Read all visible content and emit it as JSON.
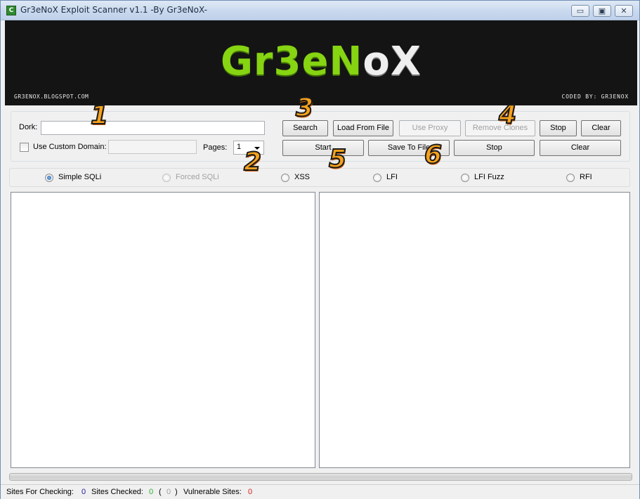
{
  "window": {
    "title": "Gr3eNoX Exploit Scanner v1.1 -By Gr3eNoX-",
    "app_icon_glyph": "C",
    "controls": {
      "minimize": "▭",
      "maximize": "▣",
      "close": "✕"
    }
  },
  "banner": {
    "logo_green": "Gr3e",
    "logo_green2": "N",
    "logo_white": "oX",
    "blog": "GR3ENOX.BLOGSPOT.COM",
    "coded_by": "CODED BY: GR3ENOX"
  },
  "search": {
    "dork_label": "Dork:",
    "dork_value": "",
    "custom_domain_label": "Use Custom Domain:",
    "custom_domain_checked": false,
    "custom_domain_value": "",
    "pages_label": "Pages:",
    "pages_value": "1"
  },
  "buttons": {
    "search": "Search",
    "load_from_file": "Load From File",
    "use_proxy": "Use Proxy",
    "remove_clones": "Remove Clones",
    "stop_top": "Stop",
    "clear_top": "Clear",
    "start": "Start",
    "save_to_file": "Save To File",
    "stop_bottom": "Stop",
    "clear_bottom": "Clear"
  },
  "scan_modes": [
    {
      "label": "Simple SQLi",
      "checked": true,
      "enabled": true
    },
    {
      "label": "Forced SQLi",
      "checked": false,
      "enabled": false
    },
    {
      "label": "XSS",
      "checked": false,
      "enabled": true
    },
    {
      "label": "LFI",
      "checked": false,
      "enabled": true
    },
    {
      "label": "LFI Fuzz",
      "checked": false,
      "enabled": true
    },
    {
      "label": "RFI",
      "checked": false,
      "enabled": true
    }
  ],
  "status": {
    "sites_for_checking_label": "Sites For Checking:",
    "sites_for_checking": "0",
    "sites_checked_label": "Sites Checked:",
    "sites_checked": "0",
    "paren_open": "(",
    "sites_checked_secondary": "0",
    "paren_close": ")",
    "vulnerable_label": "Vulnerable Sites:",
    "vulnerable": "0",
    "colors": {
      "for_checking": "#1a1aa6",
      "checked": "#2db02d",
      "secondary": "#a0a0a0",
      "vulnerable": "#d42020"
    }
  },
  "annotations": [
    "1",
    "2",
    "3",
    "4",
    "5",
    "6"
  ]
}
